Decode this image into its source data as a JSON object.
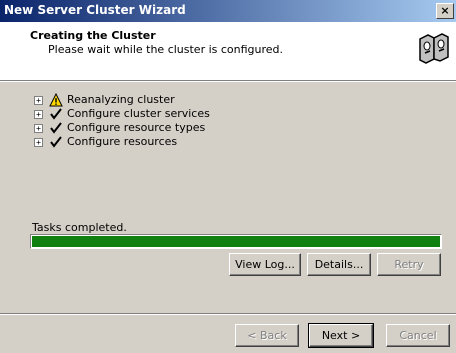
{
  "window": {
    "title": "New Server Cluster Wizard",
    "close_glyph": "×"
  },
  "header": {
    "title": "Creating the Cluster",
    "subtitle": "Please wait while the cluster is configured."
  },
  "tree": {
    "items": [
      {
        "label": "Reanalyzing cluster",
        "status": "warning",
        "icon": "warning-icon"
      },
      {
        "label": "Configure cluster services",
        "status": "done",
        "icon": "checkmark-icon"
      },
      {
        "label": "Configure resource types",
        "status": "done",
        "icon": "checkmark-icon"
      },
      {
        "label": "Configure resources",
        "status": "done",
        "icon": "checkmark-icon"
      }
    ]
  },
  "progress": {
    "label": "Tasks completed.",
    "value": 1.0,
    "color": "#108010"
  },
  "task_buttons": {
    "view_log": "View Log...",
    "details": "Details...",
    "retry": "Retry"
  },
  "nav_buttons": {
    "back": "< Back",
    "next": "Next >",
    "cancel": "Cancel"
  }
}
